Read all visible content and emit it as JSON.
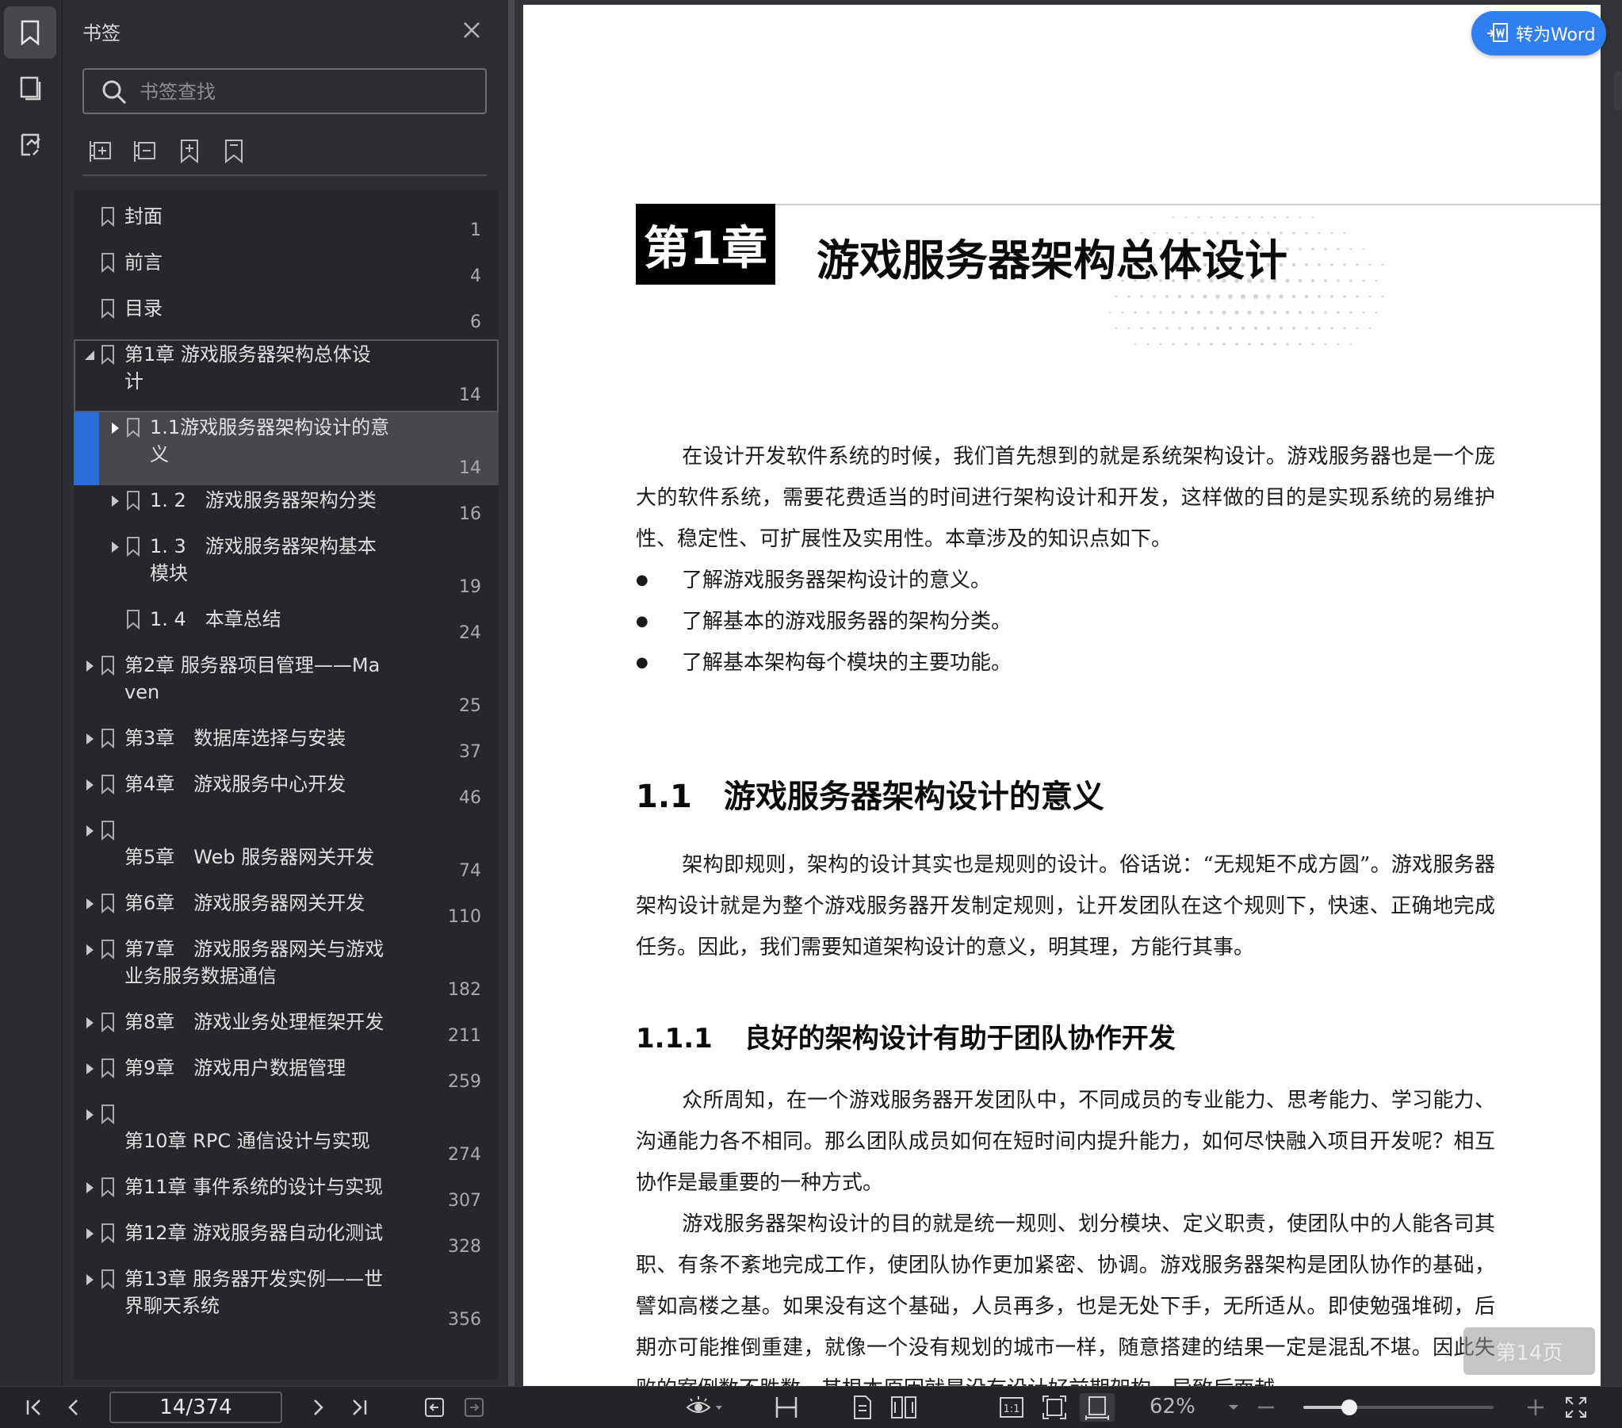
{
  "sidebar": {
    "title": "书签",
    "search_placeholder": "书签查找",
    "bookmarks": [
      {
        "label": "封面",
        "page": "1",
        "level": 0,
        "arrow": "none"
      },
      {
        "label": "前言",
        "page": "4",
        "level": 0,
        "arrow": "none"
      },
      {
        "label": "目录",
        "page": "6",
        "level": 0,
        "arrow": "none"
      },
      {
        "label": "第1章 游戏服务器架构总体设\n计",
        "page": "14",
        "level": 0,
        "arrow": "expanded"
      },
      {
        "label": "1.1游戏服务器架构设计的意\n义",
        "page": "14",
        "level": 1,
        "arrow": "collapsed"
      },
      {
        "label": "1. 2　游戏服务器架构分类",
        "page": "16",
        "level": 1,
        "arrow": "collapsed"
      },
      {
        "label": "1. 3　游戏服务器架构基本\n模块",
        "page": "19",
        "level": 1,
        "arrow": "collapsed"
      },
      {
        "label": "1. 4　本章总结",
        "page": "24",
        "level": 1,
        "arrow": "none"
      },
      {
        "label": "第2章 服务器项目管理——Ma\nven",
        "page": "25",
        "level": 0,
        "arrow": "collapsed"
      },
      {
        "label": "第3章　数据库选择与安装",
        "page": "37",
        "level": 0,
        "arrow": "collapsed"
      },
      {
        "label": "第4章　游戏服务中心开发",
        "page": "46",
        "level": 0,
        "arrow": "collapsed"
      },
      {
        "label": "\n第5章　Web 服务器网关开发",
        "page": "74",
        "level": 0,
        "arrow": "collapsed"
      },
      {
        "label": "第6章　游戏服务器网关开发",
        "page": "110",
        "level": 0,
        "arrow": "collapsed"
      },
      {
        "label": "第7章　游戏服务器网关与游戏\n业务服务数据通信",
        "page": "182",
        "level": 0,
        "arrow": "collapsed"
      },
      {
        "label": "第8章　游戏业务处理框架开发",
        "page": "211",
        "level": 0,
        "arrow": "collapsed"
      },
      {
        "label": "第9章　游戏用户数据管理",
        "page": "259",
        "level": 0,
        "arrow": "collapsed"
      },
      {
        "label": "\n第10章 RPC 通信设计与实现",
        "page": "274",
        "level": 0,
        "arrow": "collapsed"
      },
      {
        "label": "第11章 事件系统的设计与实现",
        "page": "307",
        "level": 0,
        "arrow": "collapsed"
      },
      {
        "label": "第12章 游戏服务器自动化测试",
        "page": "328",
        "level": 0,
        "arrow": "collapsed"
      },
      {
        "label": "第13章 服务器开发实例——世\n界聊天系统",
        "page": "356",
        "level": 0,
        "arrow": "collapsed"
      }
    ]
  },
  "document": {
    "chapter_num": "第1章",
    "chapter_title": "游戏服务器架构总体设计",
    "intro": "在设计开发软件系统的时候，我们首先想到的就是系统架构设计。游戏服务器也是一个庞大的软件系统，需要花费适当的时间进行架构设计和开发，这样做的目的是实现系统的易维护性、稳定性、可扩展性及实用性。本章涉及的知识点如下。",
    "bullets": [
      "了解游戏服务器架构设计的意义。",
      "了解基本的游戏服务器的架构分类。",
      "了解基本架构每个模块的主要功能。"
    ],
    "section_num": "1.1",
    "section_title": "游戏服务器架构设计的意义",
    "section_para": "架构即规则，架构的设计其实也是规则的设计。俗话说：“无规矩不成方圆”。游戏服务器架构设计就是为整个游戏服务器开发制定规则，让开发团队在这个规则下，快速、正确地完成任务。因此，我们需要知道架构设计的意义，明其理，方能行其事。",
    "subsection_num": "1.1.1",
    "subsection_title": "良好的架构设计有助于团队协作开发",
    "para2": "众所周知，在一个游戏服务器开发团队中，不同成员的专业能力、思考能力、学习能力、沟通能力各不相同。那么团队成员如何在短时间内提升能力，如何尽快融入项目开发呢？相互协作是最重要的一种方式。",
    "para3": "游戏服务器架构设计的目的就是统一规则、划分模块、定义职责，使团队中的人能各司其职、有条不紊地完成工作，使团队协作更加紧密、协调。游戏服务器架构是团队协作的基础，譬如高楼之基。如果没有这个基础，人员再多，也是无处下手，无所适从。即使勉强堆砌，后期亦可能推倒重建，就像一个没有规划的城市一样，随意搭建的结果一定是混乱不堪。因此失败的案例数不胜数，其根本原因就是没有设计好前期架构，导致后面越"
  },
  "overlay": {
    "to_word": "转为Word",
    "page_badge": "第14页"
  },
  "toolbar": {
    "page_field": "14/374",
    "zoom": "62%",
    "zoom_fraction": 0.24
  },
  "colors": {
    "accent": "#2a6ed8",
    "button": "#2f7ef2"
  }
}
